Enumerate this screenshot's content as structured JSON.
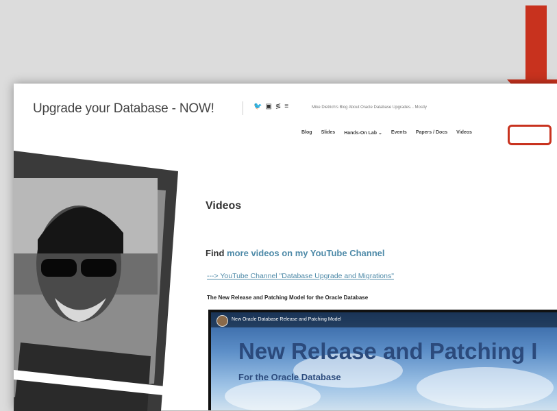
{
  "header": {
    "site_title": "Upgrade your Database - NOW!",
    "tagline": "Mike Dietrich's Blog About Oracle Database Upgrades... Mostly",
    "social_icons": [
      "twitter-icon",
      "linkedin-icon",
      "share-icon",
      "rss-icon"
    ]
  },
  "nav": {
    "items": [
      "Blog",
      "Slides",
      "Hands-On Lab ⌄",
      "Events",
      "Papers / Docs",
      "Videos"
    ],
    "active": "Videos"
  },
  "main": {
    "heading": "Videos",
    "find_prefix": "Find ",
    "find_link": "more videos on my YouTube Channel",
    "yt_link": "---> YouTube Channel \"Database Upgrade and Migrations\"",
    "section_title": "The New Release and Patching Model for the Oracle Database"
  },
  "video": {
    "caption": "New Oracle Database Release and Patching Model",
    "title": "New Release and Patching I",
    "subtitle": "For the Oracle Database"
  },
  "colors": {
    "accent_red": "#c8321e",
    "link_blue": "#4e8aa8"
  }
}
